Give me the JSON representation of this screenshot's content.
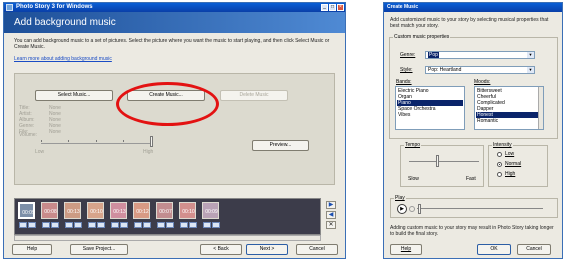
{
  "window": {
    "title": "Photo Story 3 for Windows",
    "header": "Add background music",
    "intro": "You can add background music to a set of pictures.  Select the picture where you want the music to start playing, and then click Select Music or Create Music.",
    "learn_link": "Learn more about adding background music",
    "select_music": "Select Music...",
    "create_music": "Create Music...",
    "delete_music": "Delete Music",
    "props": [
      {
        "label": "Title:",
        "value": "None"
      },
      {
        "label": "Artist:",
        "value": "None"
      },
      {
        "label": "Album:",
        "value": "None"
      },
      {
        "label": "Genre:",
        "value": "None"
      },
      {
        "label": "File:",
        "value": "None"
      }
    ],
    "volume_label": "Volume:",
    "volume_low": "Low",
    "volume_high": "High",
    "volume_level": 1.0,
    "preview": "Preview...",
    "thumbnails": [
      "00:09",
      "00:08",
      "00:13",
      "00:10",
      "00:13",
      "00:12",
      "00:07",
      "00:10",
      "00:09"
    ],
    "selected_thumbnail": 0,
    "help": "Help",
    "save_project": "Save Project...",
    "back": "< Back",
    "next": "Next >",
    "cancel": "Cancel"
  },
  "dialog": {
    "title": "Create Music",
    "intro": "Add customized music to your story by selecting musical properties that best match your story.",
    "group_label": "Custom music properties",
    "genre_label": "Genre:",
    "genre_value": "Pop",
    "style_label": "Style:",
    "style_value": "Pop: Heartland",
    "bands_label": "Bands:",
    "bands": [
      "Electric Piano",
      "Organ",
      "Piano",
      "Space Orchestra",
      "Vibes"
    ],
    "bands_selected": 2,
    "moods_label": "Moods:",
    "moods": [
      "Bittersweet",
      "Cheerful",
      "Complicated",
      "Dapper",
      "Honest",
      "Romantic"
    ],
    "moods_selected": 4,
    "tempo_label": "Tempo",
    "tempo_slow": "Slow",
    "tempo_fast": "Fast",
    "tempo_level": 0.4,
    "intensity_label": "Intensity",
    "intensity_options": [
      "Low",
      "Normal",
      "High"
    ],
    "intensity_selected": 1,
    "play_label": "Play",
    "footer": "Adding custom music to your story may result in Photo Story taking longer to build the final story.",
    "help": "Help",
    "ok": "OK",
    "cancel": "Cancel"
  }
}
